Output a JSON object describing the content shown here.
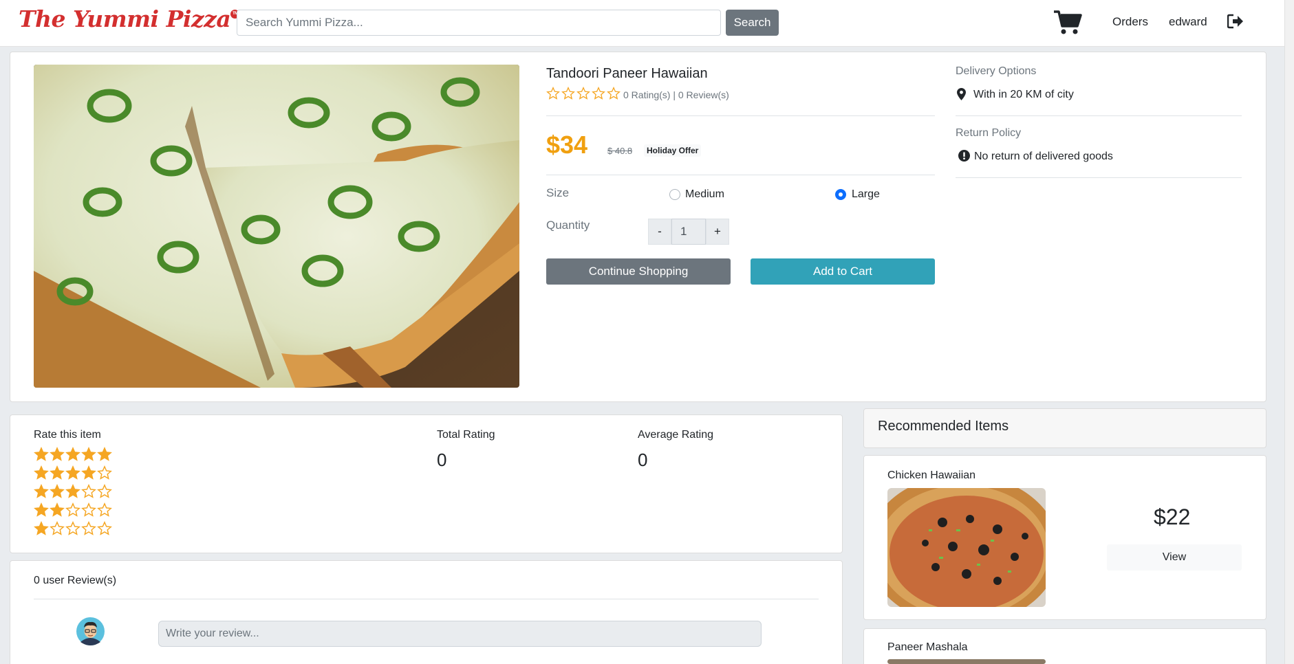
{
  "nav": {
    "logo": "The Yummi Pizza",
    "logo_tm": "TM",
    "search_placeholder": "Search Yummi Pizza...",
    "search_button": "Search",
    "orders": "Orders",
    "user": "edward",
    "icons": [
      "cart-icon",
      "logout-icon"
    ]
  },
  "product": {
    "name": "Tandoori Paneer Hawaiian",
    "rating_stars": 0,
    "rating_text": "0 Rating(s) | 0 Review(s)",
    "price": "$34",
    "old_price": "$ 40.8",
    "offer": "Holiday Offer",
    "size_label": "Size",
    "sizes": [
      {
        "label": "Medium",
        "selected": false
      },
      {
        "label": "Large",
        "selected": true
      }
    ],
    "quantity_label": "Quantity",
    "quantity": "1",
    "qty_minus": "-",
    "qty_plus": "+",
    "continue_button": "Continue Shopping",
    "add_button": "Add to Cart"
  },
  "delivery": {
    "title": "Delivery Options",
    "text": "With in 20 KM of city",
    "return_title": "Return Policy",
    "return_text": "No return of delivered goods"
  },
  "rating": {
    "rate_title": "Rate this item",
    "star_options": [
      5,
      4,
      3,
      2,
      1
    ],
    "total_label": "Total Rating",
    "total_value": "0",
    "avg_label": "Average Rating",
    "avg_value": "0"
  },
  "reviews": {
    "count_text": "0 user Review(s)",
    "placeholder": "Write your review..."
  },
  "recommended": {
    "title": "Recommended Items",
    "items": [
      {
        "name": "Chicken Hawaiian",
        "price": "$22",
        "view": "View"
      },
      {
        "name": "Paneer Mashala"
      }
    ]
  },
  "colors": {
    "brand_red": "#d32f2f",
    "price_orange": "#f0a010",
    "star_orange": "#f5a623",
    "add_to_cart": "#31a2b8",
    "secondary": "#6c757d",
    "radio_blue": "#0d6efd"
  }
}
